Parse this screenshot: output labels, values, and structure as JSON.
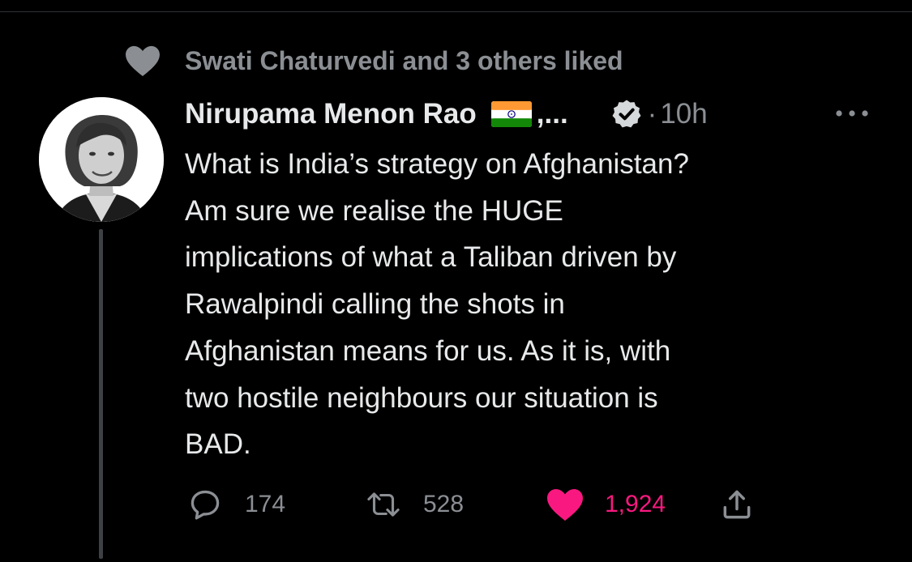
{
  "social_context": {
    "text": "Swati Chaturvedi and 3 others liked",
    "icon": "heart-icon"
  },
  "tweet": {
    "display_name": "Nirupama Menon Rao",
    "name_suffix": ",...",
    "flag_icon": "india-flag-icon",
    "verified_icon": "verified-badge-icon",
    "separator": "·",
    "time": "10h",
    "text": "What is India’s strategy on Afghanistan?\nAm sure we realise  the HUGE\nimplications of what a Taliban driven by\nRawalpindi  calling the shots in\nAfghanistan means for us. As it is, with\ntwo hostile neighbours our situation is\nBAD.",
    "actions": {
      "replies": "174",
      "retweets": "528",
      "likes": "1,924"
    }
  },
  "colors": {
    "background": "#000000",
    "text_primary": "#e7e9ea",
    "text_secondary": "#8b8f94",
    "like_active": "#f91880"
  }
}
